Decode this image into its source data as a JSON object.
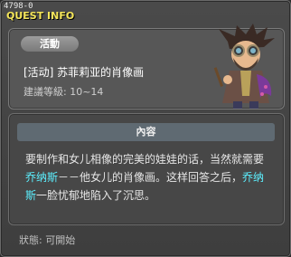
{
  "window": {
    "quest_id": "4798-0",
    "title": "QUEST INFO"
  },
  "quest": {
    "badge": "活動",
    "name": "[活动] 苏菲莉亚的肖像画",
    "level": "建議等級: 10~14"
  },
  "content": {
    "header": "內容",
    "text_1": "要制作和女儿相像的完美的娃娃的话，当然就需要",
    "highlight_1": "乔纳斯",
    "text_2": "－－他女儿的肖像画。这样回答之后，",
    "highlight_2": "乔纳斯",
    "text_3": "一脸忧郁地陷入了沉思。"
  },
  "status": {
    "label": "狀態:  可開始"
  },
  "colors": {
    "title": "#f5e65a",
    "highlight": "#5cf0ff",
    "panel": "#575757"
  }
}
